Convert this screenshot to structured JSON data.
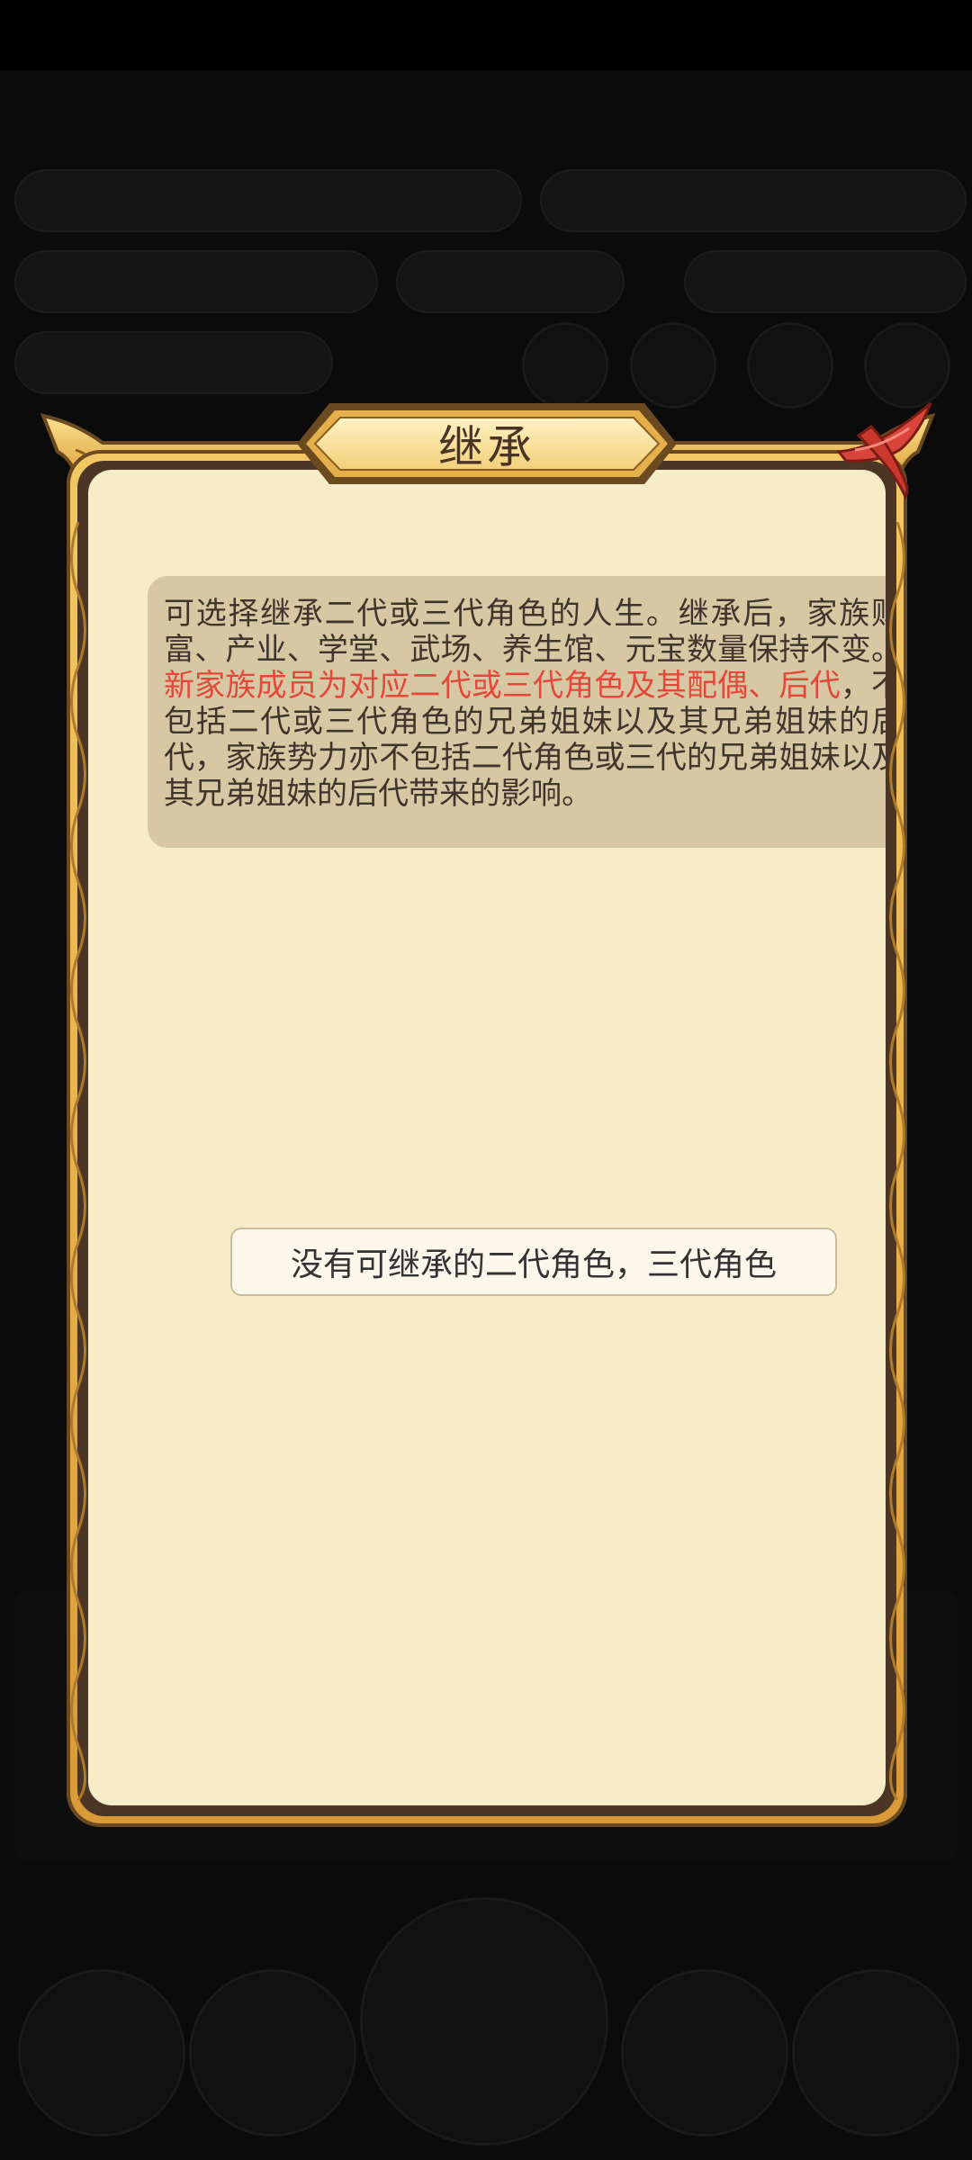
{
  "dialog": {
    "title": "继承",
    "description_part1": "可选择继承二代或三代角色的人生。继承后，家族财富、产业、学堂、武场、养生馆、元宝数量保持不变。",
    "description_highlight": "新家族成员为对应二代或三代角色及其配偶、后代",
    "description_part2": "，不包括二代或三代角色的兄弟姐妹以及其兄弟姐妹的后代，家族势力亦不包括二代角色或三代的兄弟姐妹以及其兄弟姐妹的后代带来的影响。",
    "empty_message": "没有可继承的二代角色，三代角色",
    "close_icon": "close-icon"
  },
  "colors": {
    "frame_gold": "#e9b24c",
    "panel_cream": "#f6ecc8",
    "desc_box": "#d7c8a3",
    "highlight_red": "#e4483a",
    "close_red": "#d9453a"
  }
}
